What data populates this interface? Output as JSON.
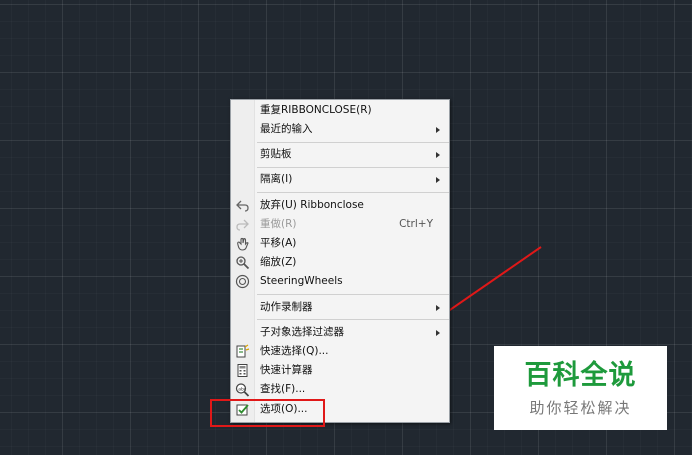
{
  "context_menu": {
    "items": [
      {
        "label": "重复RIBBONCLOSE(R)"
      },
      {
        "label": "最近的输入"
      },
      {
        "label": "剪贴板"
      },
      {
        "label": "隔离(I)"
      },
      {
        "label": "放弃(U) Ribbonclose",
        "icon": "undo-icon"
      },
      {
        "label": "重做(R)",
        "shortcut": "Ctrl+Y",
        "icon": "redo-icon"
      },
      {
        "label": "平移(A)",
        "icon": "pan-hand-icon"
      },
      {
        "label": "缩放(Z)",
        "icon": "zoom-magnifier-icon"
      },
      {
        "label": "SteeringWheels",
        "icon": "steering-wheel-icon"
      },
      {
        "label": "动作录制器"
      },
      {
        "label": "子对象选择过滤器"
      },
      {
        "label": "快速选择(Q)...",
        "icon": "quick-select-icon"
      },
      {
        "label": "快速计算器",
        "icon": "calculator-icon"
      },
      {
        "label": "查找(F)...",
        "icon": "find-text-icon"
      },
      {
        "label": "选项(O)...",
        "icon": "options-checkbox-icon"
      }
    ]
  },
  "watermark": {
    "title": "百科全说",
    "subtitle": "助你轻松解决"
  },
  "colors": {
    "canvas_bg": "#212830",
    "annotation_red": "#e01818",
    "watermark_green": "#1e9a3c"
  }
}
